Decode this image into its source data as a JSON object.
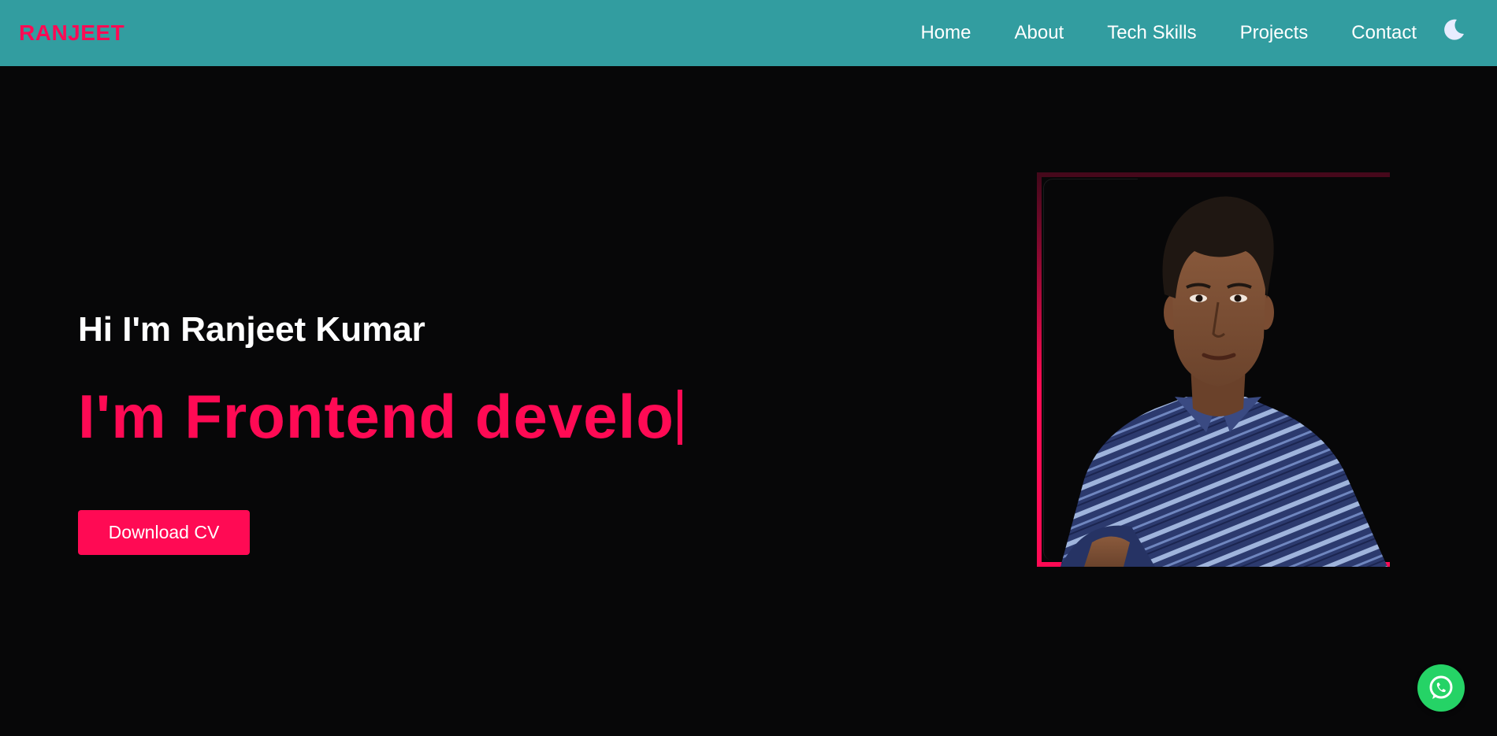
{
  "header": {
    "logo": "RANJEET",
    "nav": [
      "Home",
      "About",
      "Tech Skills",
      "Projects",
      "Contact"
    ],
    "theme_icon": "moon-icon"
  },
  "hero": {
    "greeting": "Hi I'm Ranjeet Kumar",
    "role_text": "I'm Frontend develo",
    "cta_label": "Download CV",
    "photo": "portrait-photo"
  },
  "floating": {
    "whatsapp_icon": "whatsapp-icon"
  },
  "colors": {
    "navbar": "#329da0",
    "accent": "#ff0a54",
    "background": "#070708",
    "whatsapp": "#25d366"
  }
}
